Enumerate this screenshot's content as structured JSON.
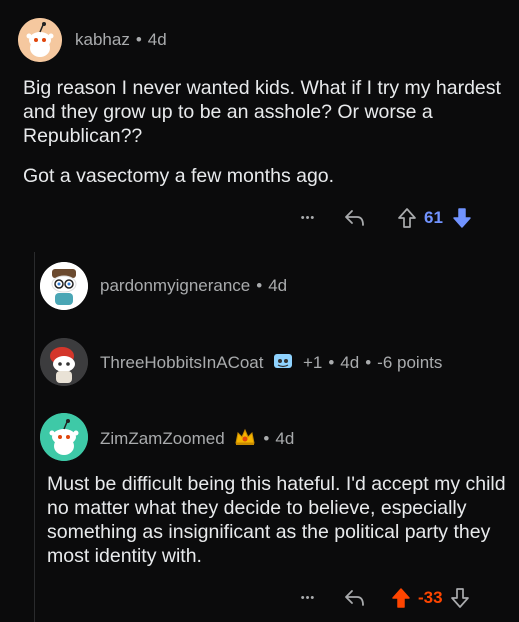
{
  "comments": [
    {
      "user": "kabhaz",
      "age": "4d",
      "body": [
        "Big reason I never wanted kids. What if I try my hardest and they grow up to be an asshole? Or worse a Republican??",
        "Got a vasectomy a few months ago."
      ],
      "score": "61",
      "vote_state": "downvoted",
      "avatar_color": "#f5c89f"
    },
    {
      "user": "pardonmyignerance",
      "age": "4d"
    },
    {
      "user": "ThreeHobbitsInACoat",
      "award_count": "+1",
      "age": "4d",
      "points": "-6 points"
    },
    {
      "user": "ZimZamZoomed",
      "age": "4d",
      "body": [
        "Must be difficult being this hateful. I'd accept my child no matter what they decide to believe, especially something as insignificant as the political party they most identity with."
      ],
      "score": "-33",
      "vote_state": "upvoted",
      "avatar_color": "#3ec9a7"
    }
  ],
  "actions": {
    "more": "•••"
  },
  "colors": {
    "upvote": "#ff4500",
    "downvote": "#7193ff",
    "background": "#0b0b0c"
  }
}
